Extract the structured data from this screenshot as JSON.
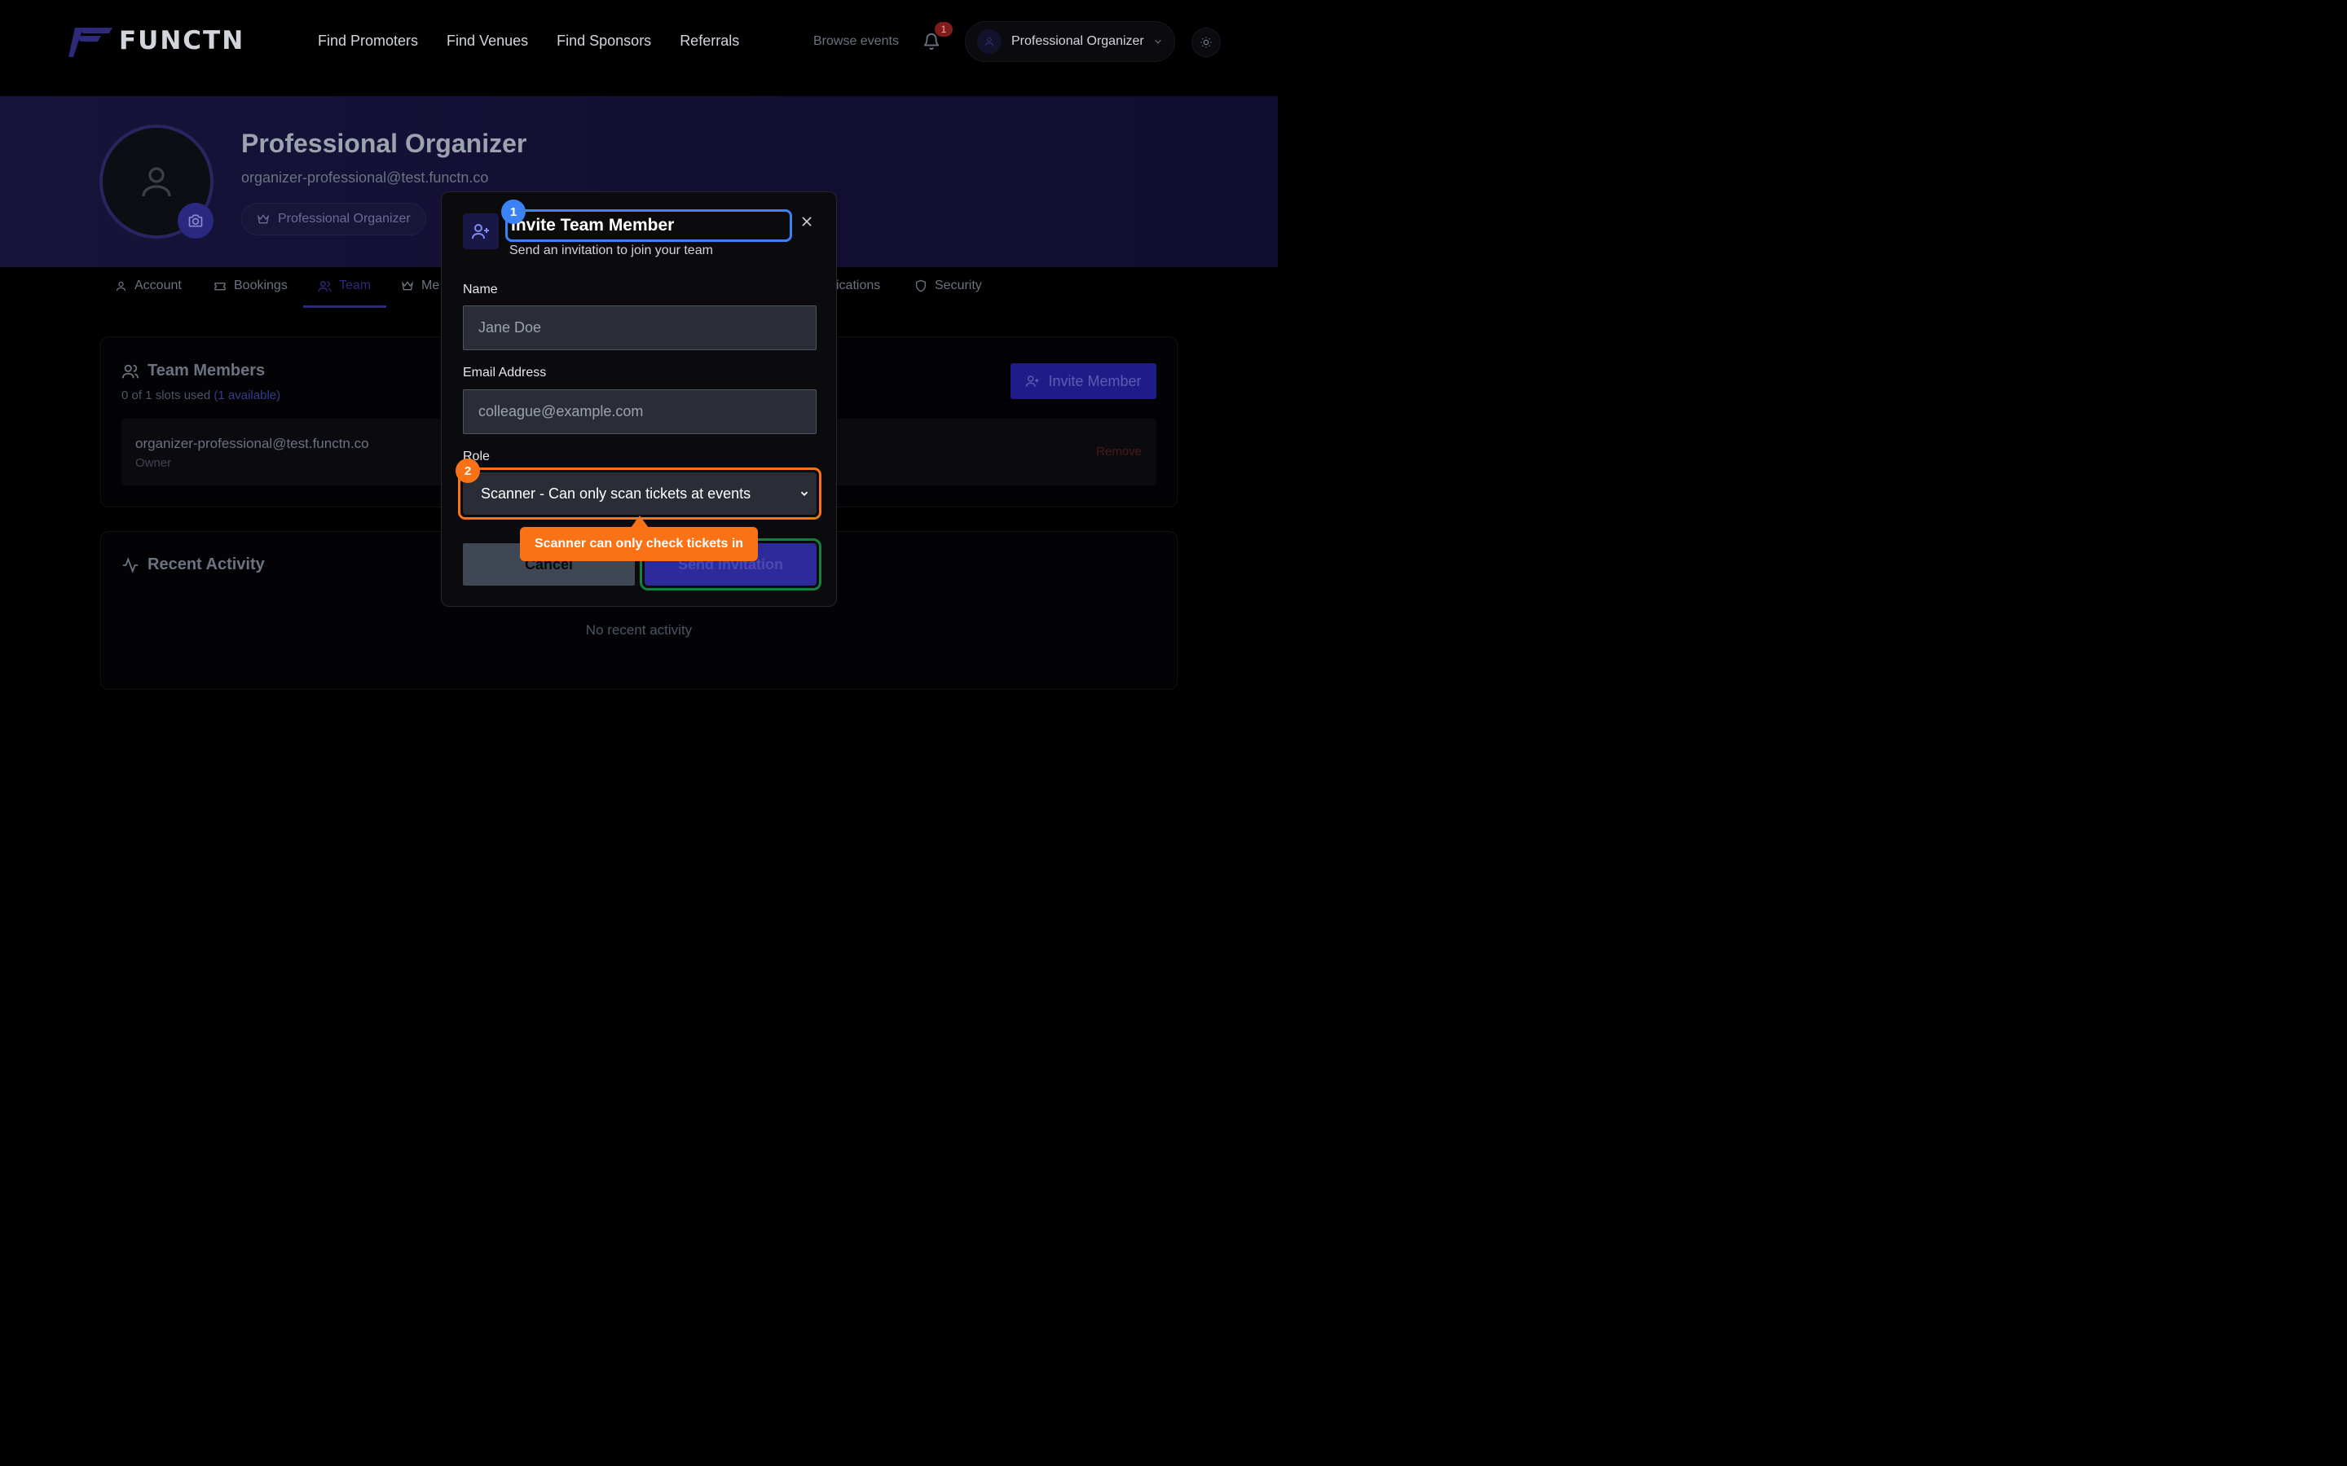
{
  "header": {
    "logo_text": "FUNCTN",
    "nav": [
      "Find Promoters",
      "Find Venues",
      "Find Sponsors",
      "Referrals"
    ],
    "browse_events": "Browse events",
    "notification_count": "1",
    "user_menu_label": "Professional Organizer"
  },
  "profile": {
    "name": "Professional Organizer",
    "email": "organizer-professional@test.functn.co",
    "role_chip": "Professional Organizer"
  },
  "tabs": [
    {
      "label": "Account"
    },
    {
      "label": "Bookings"
    },
    {
      "label": "Team",
      "active": true
    },
    {
      "label": "Me"
    },
    {
      "label": "ications"
    },
    {
      "label": "Security"
    }
  ],
  "team": {
    "title": "Team Members",
    "slots_used": "0 of 1 slots used",
    "slots_available": "(1 available)",
    "invite_button": "Invite Member",
    "members": [
      {
        "email": "organizer-professional@test.functn.co",
        "role": "Owner",
        "action": "Remove"
      }
    ]
  },
  "activity": {
    "title": "Recent Activity",
    "empty": "No recent activity"
  },
  "modal": {
    "title": "Invite Team Member",
    "subtitle": "Send an invitation to join your team",
    "name_label": "Name",
    "name_placeholder": "Jane Doe",
    "email_label": "Email Address",
    "email_placeholder": "colleague@example.com",
    "role_label": "Role",
    "role_value": "Scanner - Can only scan tickets at events",
    "cancel": "Cancel",
    "send": "Send Invitation"
  },
  "annotations": {
    "marker_1": "1",
    "marker_2": "2",
    "tooltip": "Scanner can only check tickets in"
  },
  "colors": {
    "accent": "#3b82f6",
    "highlight": "#f97316",
    "primary_button": "#2d2a9c",
    "success_outline": "#15803d"
  }
}
